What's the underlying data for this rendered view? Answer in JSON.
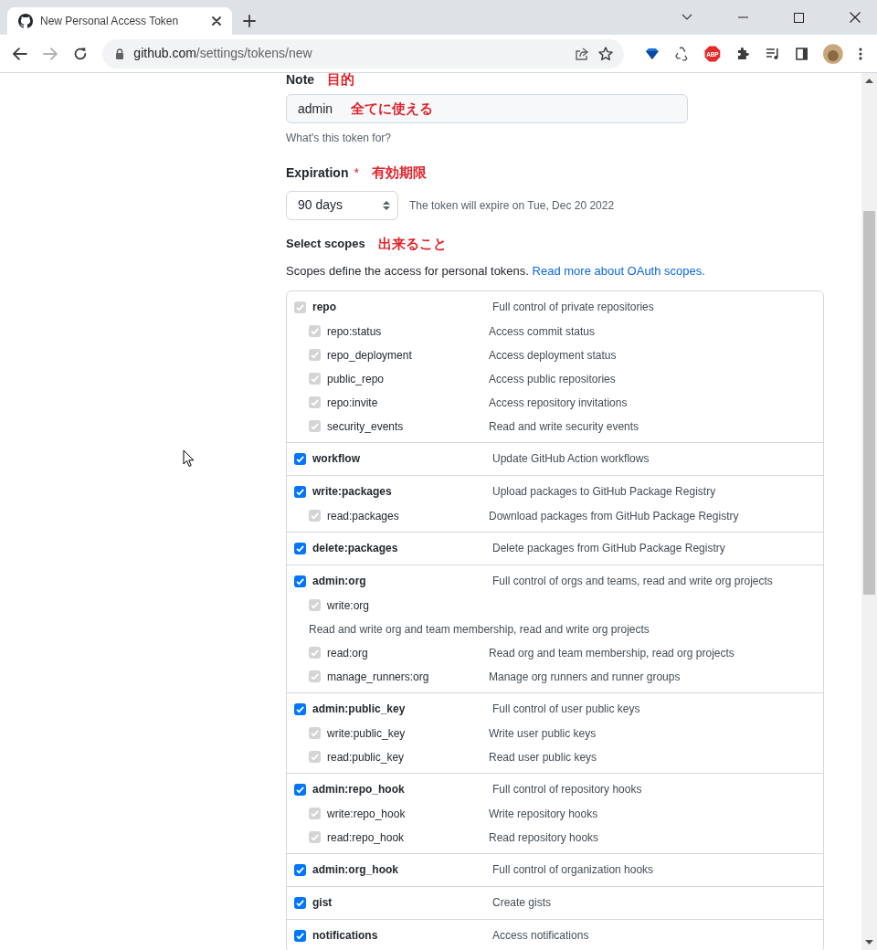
{
  "browser": {
    "tab": {
      "title": "New Personal Access Token",
      "selected": true
    },
    "url": {
      "host": "github.com",
      "path": "/settings/tokens/new"
    },
    "abp_label": "ABP"
  },
  "form": {
    "note": {
      "label": "Note",
      "annotation": "目的",
      "value": "admin",
      "value_annotation": "全てに使える",
      "hint": "What's this token for?"
    },
    "expiration": {
      "label": "Expiration",
      "required_mark": "*",
      "annotation": "有効期限",
      "value": "90 days",
      "info": "The token will expire on Tue, Dec 20 2022"
    },
    "scopes": {
      "label": "Select scopes",
      "annotation": "出来ること",
      "intro": "Scopes define the access for personal tokens.",
      "link": "Read more about OAuth scopes.",
      "groups": [
        {
          "name": "repo",
          "description": "Full control of private repositories",
          "checked": true,
          "disabled": true,
          "children": [
            {
              "kind": "row",
              "name": "repo:status",
              "description": "Access commit status",
              "checked": true,
              "disabled": true
            },
            {
              "kind": "row",
              "name": "repo_deployment",
              "description": "Access deployment status",
              "checked": true,
              "disabled": true
            },
            {
              "kind": "row",
              "name": "public_repo",
              "description": "Access public repositories",
              "checked": true,
              "disabled": true
            },
            {
              "kind": "row",
              "name": "repo:invite",
              "description": "Access repository invitations",
              "checked": true,
              "disabled": true
            },
            {
              "kind": "row",
              "name": "security_events",
              "description": "Read and write security events",
              "checked": true,
              "disabled": true
            }
          ]
        },
        {
          "name": "workflow",
          "description": "Update GitHub Action workflows",
          "checked": true,
          "disabled": false
        },
        {
          "name": "write:packages",
          "description": "Upload packages to GitHub Package Registry",
          "checked": true,
          "disabled": false,
          "children": [
            {
              "kind": "row",
              "name": "read:packages",
              "description": "Download packages from GitHub Package Registry",
              "checked": true,
              "disabled": true
            }
          ]
        },
        {
          "name": "delete:packages",
          "description": "Delete packages from GitHub Package Registry",
          "checked": true,
          "disabled": false
        },
        {
          "name": "admin:org",
          "description": "Full control of orgs and teams, read and write org projects",
          "checked": true,
          "disabled": false,
          "children": [
            {
              "kind": "wrapped",
              "name": "write:org",
              "description": "Read and write org and team membership, read and write org projects",
              "checked": true,
              "disabled": true
            },
            {
              "kind": "row",
              "name": "read:org",
              "description": "Read org and team membership, read org projects",
              "checked": true,
              "disabled": true
            },
            {
              "kind": "row",
              "name": "manage_runners:org",
              "description": "Manage org runners and runner groups",
              "checked": true,
              "disabled": true
            }
          ]
        },
        {
          "name": "admin:public_key",
          "description": "Full control of user public keys",
          "checked": true,
          "disabled": false,
          "children": [
            {
              "kind": "row",
              "name": "write:public_key",
              "description": "Write user public keys",
              "checked": true,
              "disabled": true
            },
            {
              "kind": "row",
              "name": "read:public_key",
              "description": "Read user public keys",
              "checked": true,
              "disabled": true
            }
          ]
        },
        {
          "name": "admin:repo_hook",
          "description": "Full control of repository hooks",
          "checked": true,
          "disabled": false,
          "children": [
            {
              "kind": "row",
              "name": "write:repo_hook",
              "description": "Write repository hooks",
              "checked": true,
              "disabled": true
            },
            {
              "kind": "row",
              "name": "read:repo_hook",
              "description": "Read repository hooks",
              "checked": true,
              "disabled": true
            }
          ]
        },
        {
          "name": "admin:org_hook",
          "description": "Full control of organization hooks",
          "checked": true,
          "disabled": false
        },
        {
          "name": "gist",
          "description": "Create gists",
          "checked": true,
          "disabled": false
        },
        {
          "name": "notifications",
          "description": "Access notifications",
          "checked": true,
          "disabled": false
        }
      ]
    }
  }
}
